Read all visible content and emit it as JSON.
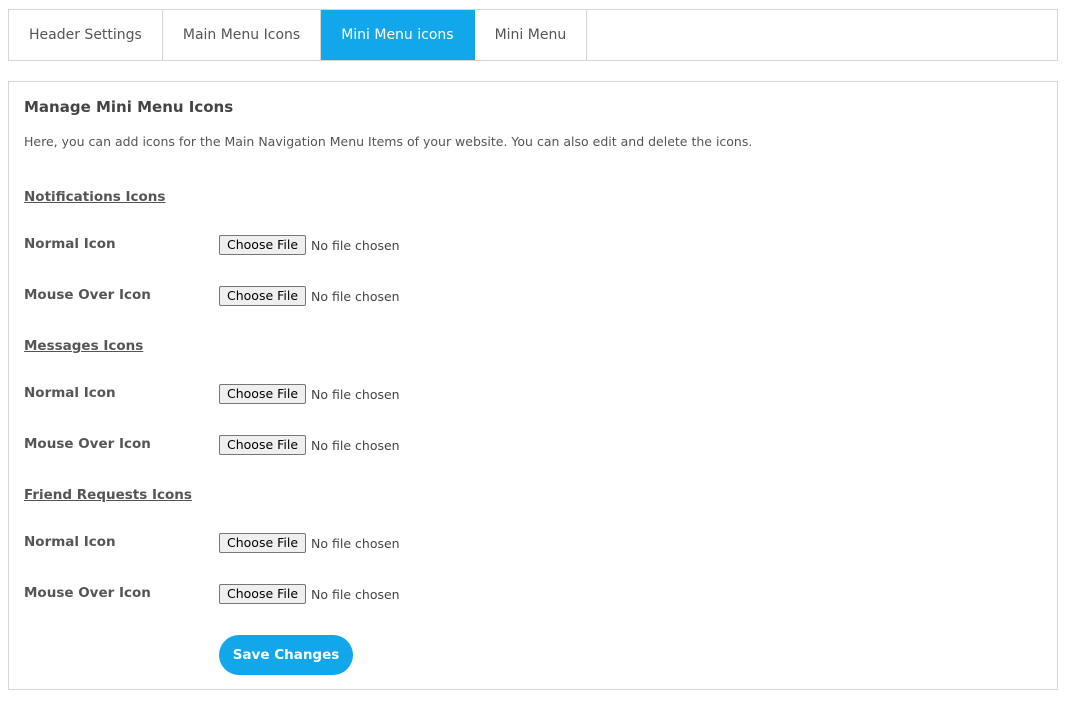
{
  "tabs": [
    {
      "label": "Header Settings",
      "active": false
    },
    {
      "label": "Main Menu Icons",
      "active": false
    },
    {
      "label": "Mini Menu icons",
      "active": true
    },
    {
      "label": "Mini Menu",
      "active": false
    }
  ],
  "panel": {
    "title": "Manage Mini Menu Icons",
    "description": "Here, you can add icons for the Main Navigation Menu Items of your website. You can also edit and delete the icons."
  },
  "sections": [
    {
      "heading": "Notifications Icons",
      "fields": [
        {
          "label": "Normal Icon",
          "button": "Choose File",
          "status": "No file chosen"
        },
        {
          "label": "Mouse Over Icon",
          "button": "Choose File",
          "status": "No file chosen"
        }
      ]
    },
    {
      "heading": "Messages Icons",
      "fields": [
        {
          "label": "Normal Icon",
          "button": "Choose File",
          "status": "No file chosen"
        },
        {
          "label": "Mouse Over Icon",
          "button": "Choose File",
          "status": "No file chosen"
        }
      ]
    },
    {
      "heading": "Friend Requests Icons",
      "fields": [
        {
          "label": "Normal Icon",
          "button": "Choose File",
          "status": "No file chosen"
        },
        {
          "label": "Mouse Over Icon",
          "button": "Choose File",
          "status": "No file chosen"
        }
      ]
    }
  ],
  "save_label": "Save Changes",
  "colors": {
    "accent": "#11a7ea",
    "border": "#d6d6d6",
    "text": "#555555"
  }
}
